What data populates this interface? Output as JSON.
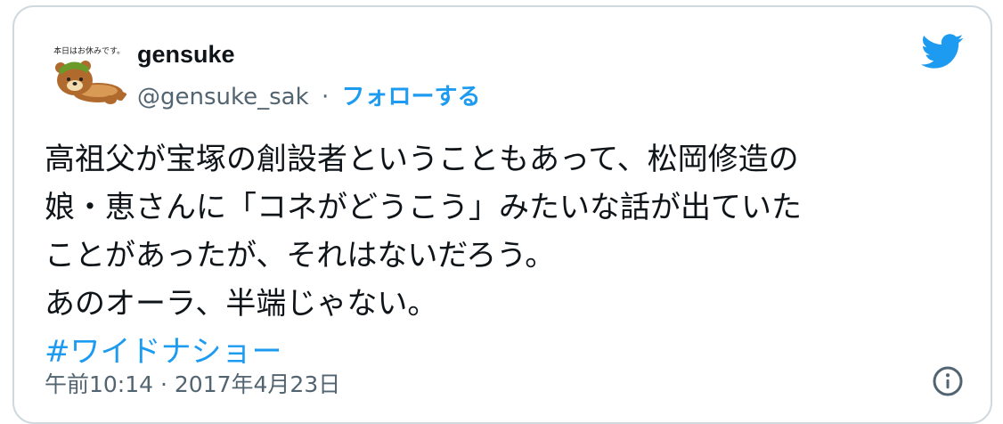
{
  "tweet": {
    "avatar": {
      "caption": "本日はお休みです。",
      "icon": "bear-mascot-avatar-icon"
    },
    "author": {
      "display_name": "gensuke",
      "handle": "@gensuke_sak",
      "separator": "·",
      "follow_label": "フォローする"
    },
    "logo_icon": "twitter-bird-icon",
    "body_lines": [
      "高祖父が宝塚の創設者ということもあって、松岡修造の",
      "娘・恵さんに「コネがどうこう」みたいな話が出ていた",
      "ことがあったが、それはないだろう。",
      "あのオーラ、半端じゃない。"
    ],
    "hashtag": "#ワイドナショー",
    "timestamp": "午前10:14 · 2017年4月23日",
    "info_icon": "info-icon"
  },
  "colors": {
    "accent": "#1d9bf0",
    "text": "#0f1419",
    "secondary_text": "#536471",
    "border": "#cfd9de"
  }
}
